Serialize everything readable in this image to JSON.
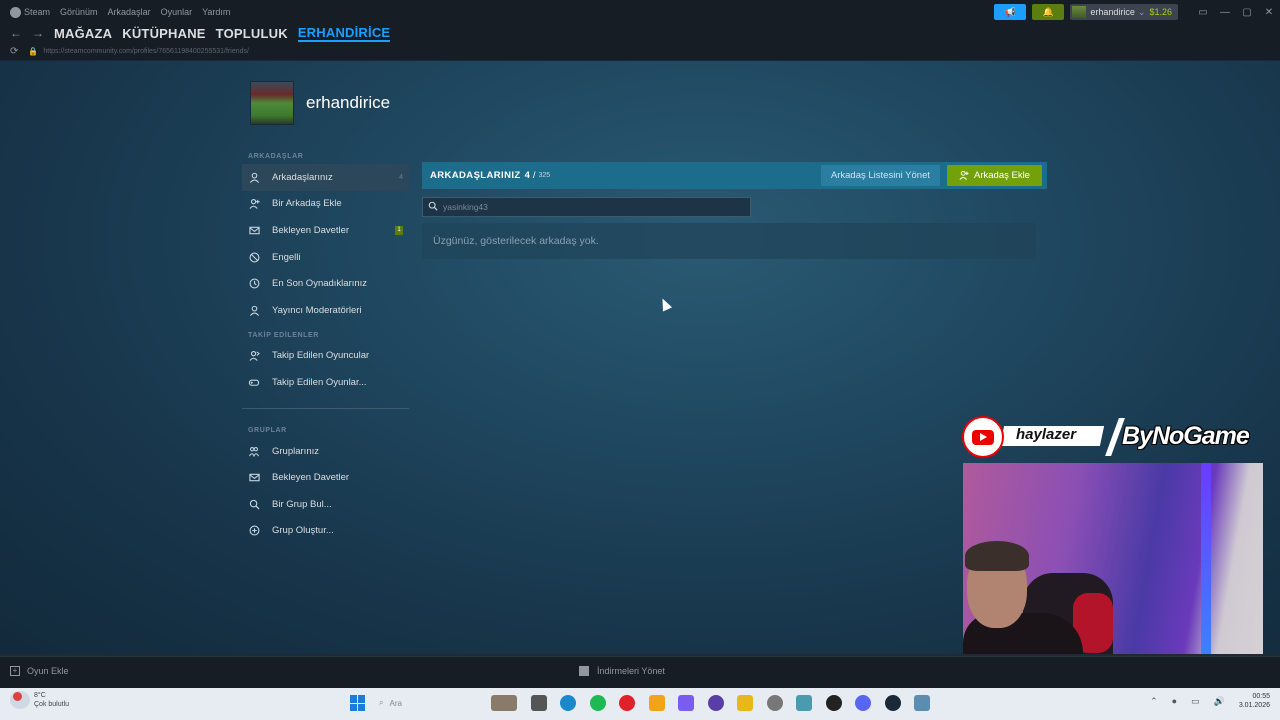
{
  "menubar": {
    "items": [
      "Steam",
      "Görünüm",
      "Arkadaşlar",
      "Oyunlar",
      "Yardım"
    ],
    "account_name": "erhandirice",
    "wallet": "$1.26"
  },
  "nav": {
    "links": [
      {
        "label": "MAĞAZA",
        "active": false
      },
      {
        "label": "KÜTÜPHANE",
        "active": false
      },
      {
        "label": "TOPLULUK",
        "active": false
      },
      {
        "label": "ERHANDİRİCE",
        "active": true
      }
    ],
    "url": "https://steamcommunity.com/profiles/76561198400255531/friends/"
  },
  "profile": {
    "name": "erhandirice"
  },
  "sidebar": {
    "sections": [
      {
        "title": "ARKADAŞLAR",
        "items": [
          {
            "label": "Arkadaşlarınız",
            "icon": "person-icon",
            "count": "4",
            "active": true
          },
          {
            "label": "Bir Arkadaş Ekle",
            "icon": "add-person-icon"
          },
          {
            "label": "Bekleyen Davetler",
            "icon": "envelope-icon",
            "badge": "1"
          },
          {
            "label": "Engelli",
            "icon": "block-icon"
          },
          {
            "label": "En Son Oynadıklarınız",
            "icon": "clock-icon"
          },
          {
            "label": "Yayıncı Moderatörleri",
            "icon": "person-icon"
          }
        ]
      },
      {
        "title": "TAKİP EDİLENLER",
        "items": [
          {
            "label": "Takip Edilen Oyuncular",
            "icon": "followed-players-icon"
          },
          {
            "label": "Takip Edilen Oyunlar...",
            "icon": "controller-icon"
          }
        ]
      },
      {
        "title": "GRUPLAR",
        "items": [
          {
            "label": "Gruplarınız",
            "icon": "group-icon"
          },
          {
            "label": "Bekleyen Davetler",
            "icon": "envelope-icon"
          },
          {
            "label": "Bir Grup Bul...",
            "icon": "search-icon"
          },
          {
            "label": "Grup Oluştur...",
            "icon": "plus-circle-icon"
          }
        ]
      }
    ]
  },
  "friends": {
    "title": "ARKADAŞLARINIZ",
    "count": "4",
    "separator": "/",
    "max": "325",
    "manage_button": "Arkadaş Listesini Yönet",
    "add_button": "Arkadaş Ekle",
    "search_value": "yasinking43",
    "empty_message": "Üzgünüz, gösterilecek arkadaş yok."
  },
  "overlay": {
    "channel": "haylazer",
    "brand": "ByNoGame"
  },
  "footer": {
    "add_game": "Oyun Ekle",
    "downloads": "İndirmeleri Yönet"
  },
  "taskbar": {
    "weather_temp": "8°C",
    "weather_desc": "Çok bulutlu",
    "search_label": "Ara",
    "time": "00:55",
    "date": "3.01.2026"
  },
  "colors": {
    "accent": "#1a9fff",
    "header_bar": "#1c6c8c",
    "add_button": "#72a10b",
    "manage_button": "#2a7ea2",
    "badge_green": "#5c7e10"
  }
}
